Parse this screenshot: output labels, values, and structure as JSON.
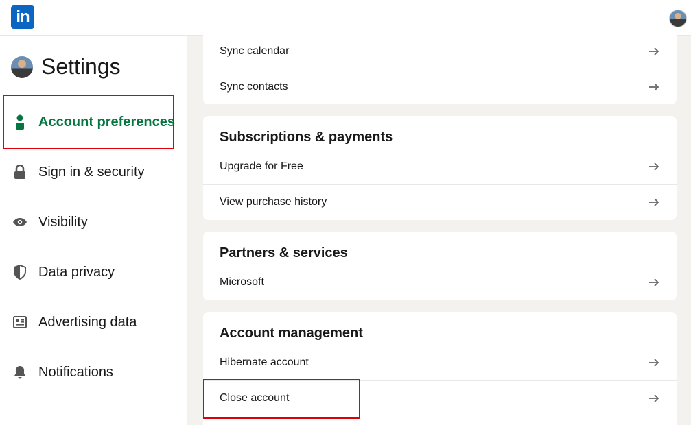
{
  "app": {
    "logo_text": "in"
  },
  "sidebar": {
    "title": "Settings",
    "items": [
      {
        "label": "Account preferences",
        "icon": "person-icon",
        "active": true
      },
      {
        "label": "Sign in & security",
        "icon": "lock-icon"
      },
      {
        "label": "Visibility",
        "icon": "eye-icon"
      },
      {
        "label": "Data privacy",
        "icon": "shield-icon"
      },
      {
        "label": "Advertising data",
        "icon": "newspaper-icon"
      },
      {
        "label": "Notifications",
        "icon": "bell-icon"
      }
    ]
  },
  "main": {
    "sync": {
      "items": [
        "Sync calendar",
        "Sync contacts"
      ]
    },
    "subscriptions": {
      "title": "Subscriptions & payments",
      "items": [
        "Upgrade for Free",
        "View purchase history"
      ]
    },
    "partners": {
      "title": "Partners & services",
      "items": [
        "Microsoft"
      ]
    },
    "account_management": {
      "title": "Account management",
      "items": [
        "Hibernate account",
        "Close account"
      ]
    }
  },
  "colors": {
    "brand": "#0a66c2",
    "active": "#057642",
    "highlight": "#e0000a",
    "background": "#f4f2ee"
  }
}
